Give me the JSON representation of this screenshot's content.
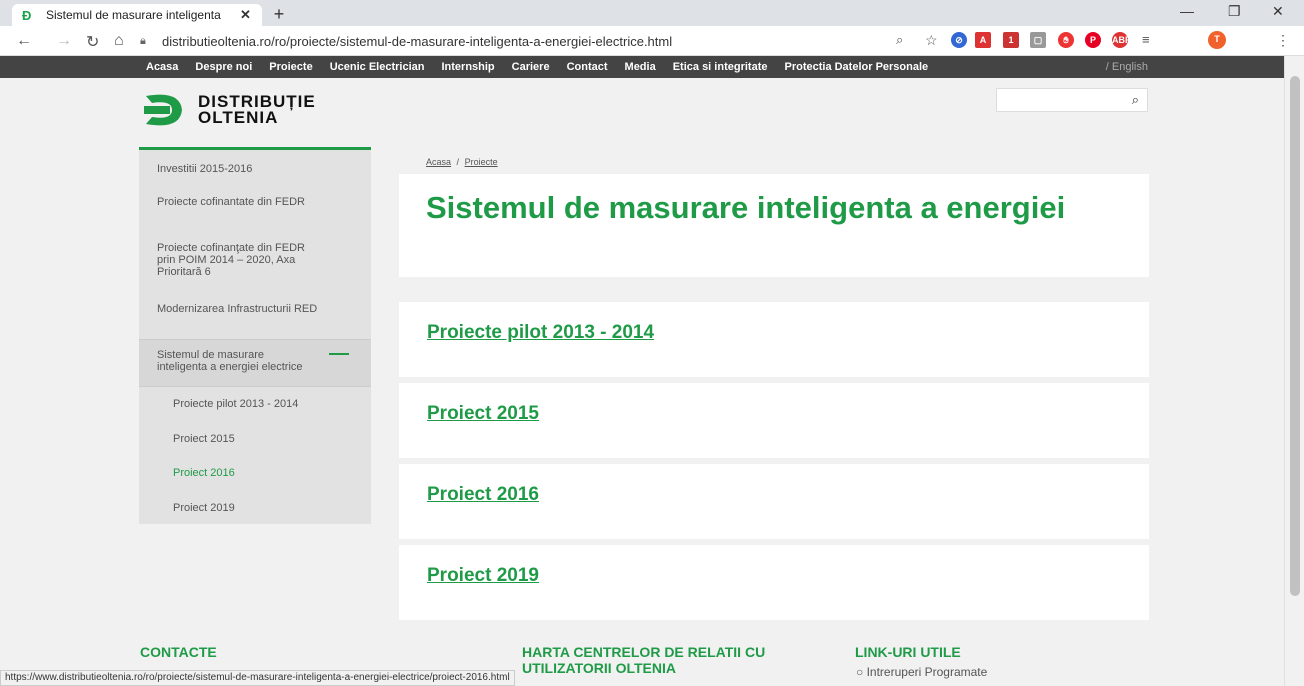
{
  "browser": {
    "tab_title": "Sistemul de masurare inteligenta",
    "url": "distributieoltenia.ro/ro/proiecte/sistemul-de-masurare-inteligenta-a-energiei-electrice.html",
    "status_url": "https://www.distributieoltenia.ro/ro/proiecte/sistemul-de-masurare-inteligenta-a-energiei-electrice/proiect-2016.html",
    "avatar_letter": "T"
  },
  "sitenav": {
    "items": [
      "Acasa",
      "Despre noi",
      "Proiecte",
      "Ucenic Electrician",
      "Internship",
      "Cariere",
      "Contact",
      "Media",
      "Etica si integritate",
      "Protectia Datelor Personale"
    ],
    "lang": "/ English"
  },
  "logo": {
    "line1": "DISTRIBUȚIE",
    "line2": "OLTENIA"
  },
  "sidebar": {
    "items": [
      "Investitii 2015-2016",
      "Proiecte cofinantate din FEDR",
      "Proiecte cofinanţate din FEDR prin POIM 2014 – 2020, Axa Prioritară 6",
      "Modernizarea Infrastructurii RED",
      "Sistemul de masurare inteligenta a energiei electrice"
    ],
    "subitems": [
      "Proiecte pilot 2013 - 2014",
      "Proiect 2015",
      "Proiect 2016",
      "Proiect 2019"
    ]
  },
  "breadcrumb": {
    "home": "Acasa",
    "sep": "/",
    "current": "Proiecte"
  },
  "page_title": "Sistemul de masurare inteligenta a energiei",
  "cards": [
    "Proiecte pilot 2013 - 2014",
    "Proiect 2015",
    "Proiect 2016",
    "Proiect 2019"
  ],
  "footer": {
    "contacte": "CONTACTE",
    "harta": "HARTA CENTRELOR DE RELATII CU UTILIZATORII OLTENIA",
    "linkuri": "LINK-URI UTILE",
    "link1": "Intreruperi Programate"
  }
}
